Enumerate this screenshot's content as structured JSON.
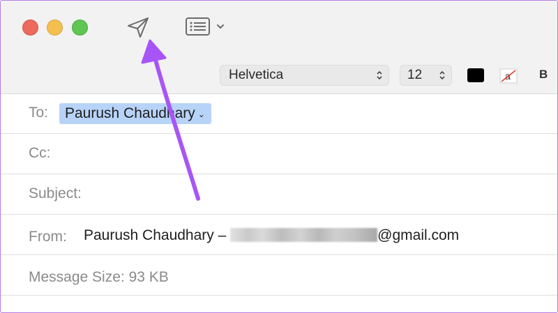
{
  "toolbar": {
    "send_icon": "paper-plane-icon",
    "header_fields_icon": "header-fields-icon",
    "dropdown_icon": "chevron-down-icon"
  },
  "format_bar": {
    "font": "Helvetica",
    "size": "12",
    "text_color": "#000000",
    "bold_label": "B"
  },
  "fields": {
    "to_label": "To:",
    "to_recipient": "Paurush Chaudhary",
    "cc_label": "Cc:",
    "subject_label": "Subject:",
    "from_label": "From:",
    "from_name": "Paurush Chaudhary –",
    "from_email_domain": "@gmail.com",
    "size_label": "Message Size: 93 KB"
  },
  "colors": {
    "annotation_arrow": "#a855f7",
    "token_highlight": "#b8d3f8"
  }
}
